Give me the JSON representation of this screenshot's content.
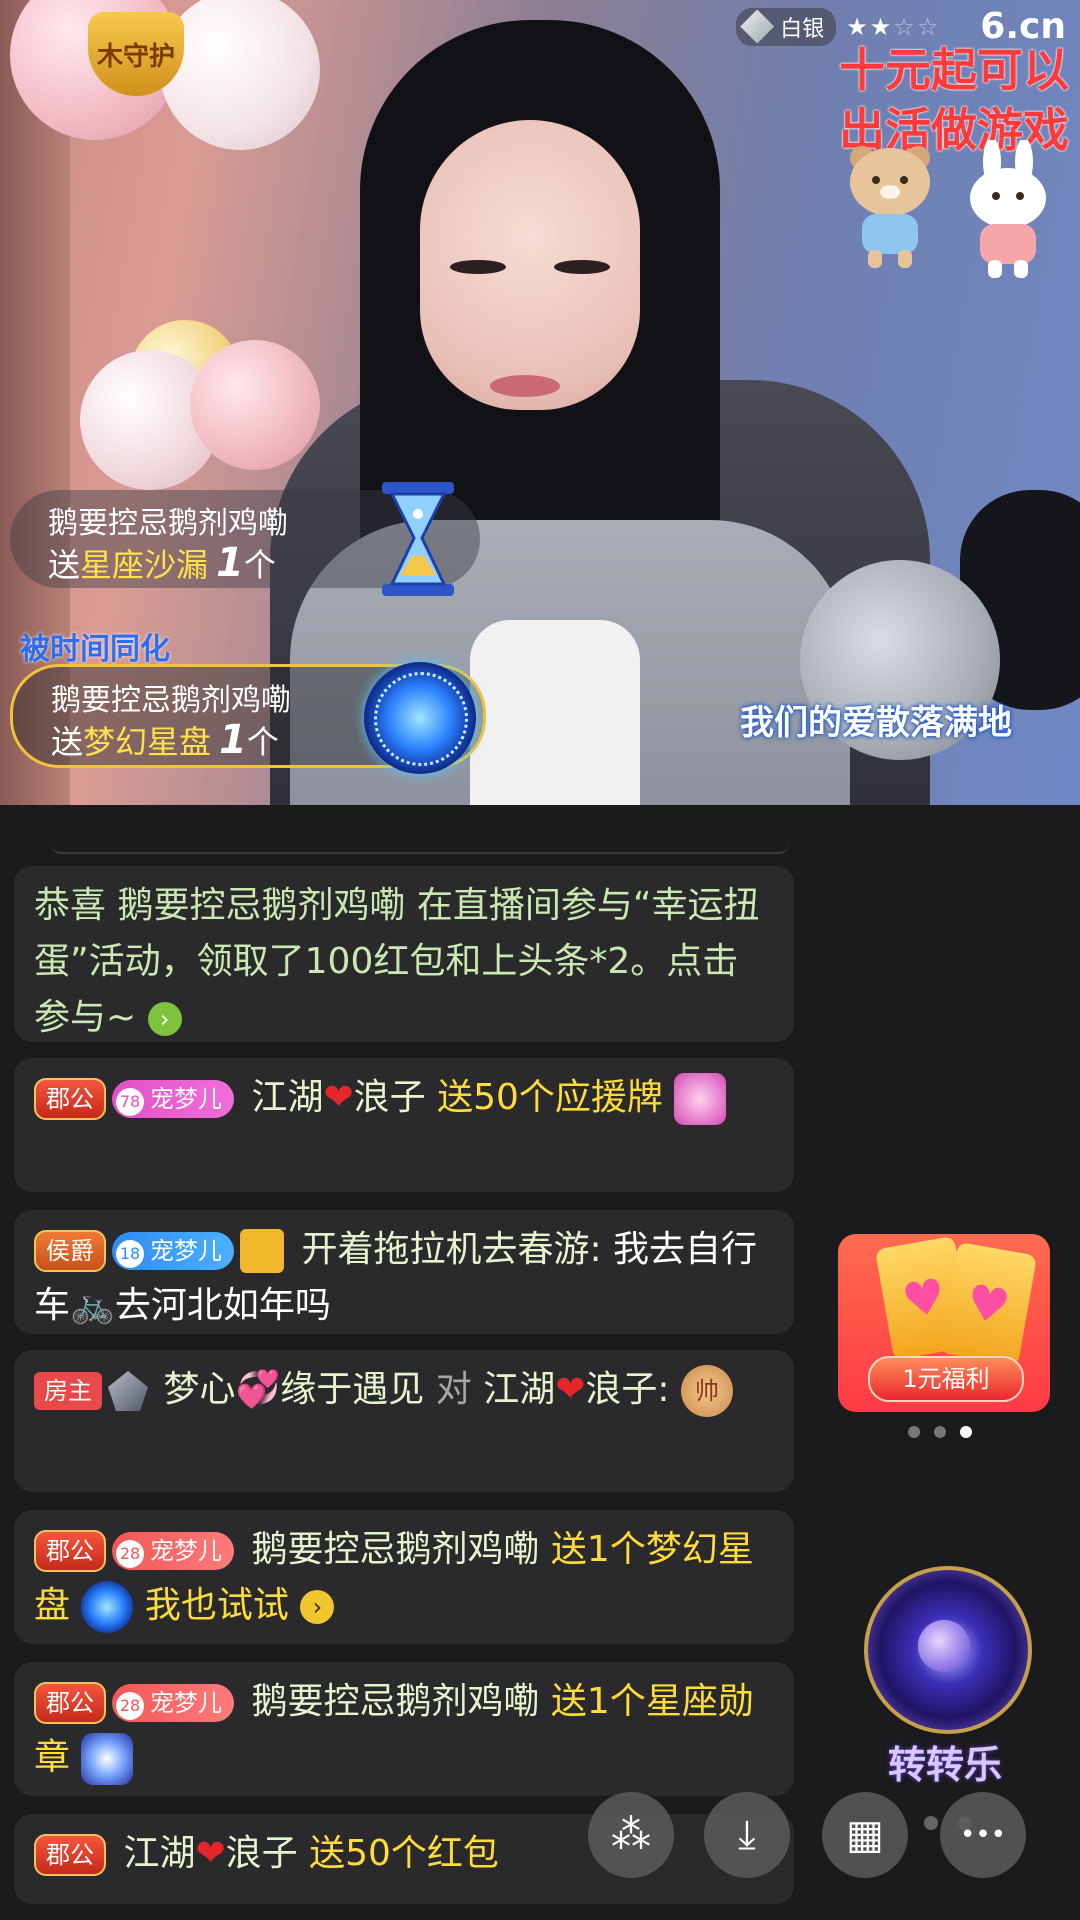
{
  "video": {
    "guard_label": "木守护",
    "rank_label": "白银",
    "stars_on": "★★",
    "stars_off": "☆☆",
    "brand": "6.cn",
    "promo_line1": "十元起可以",
    "promo_line2": "出活做游戏",
    "gift_popups": [
      {
        "user": "鹅要控忌鹅剂鸡嘞",
        "prefix": "送",
        "gift": "星座沙漏",
        "count": "1",
        "unit": "个"
      },
      {
        "user": "鹅要控忌鹅剂鸡嘞",
        "prefix": "送",
        "gift": "梦幻星盘",
        "count": "1",
        "unit": "个"
      }
    ],
    "float_title": "被时间同化",
    "lyric": "我们的爱散落满地"
  },
  "chat": {
    "msg1": {
      "p1": "恭喜 鹅要控忌鹅剂鸡嘞  在直播间参与“幸运扭蛋”活动，领取了100红包和上头条*2。点击参与~",
      "arrow": "›"
    },
    "msg2": {
      "rank": "郡公",
      "pet_level": "78",
      "pet_label": "宠梦儿",
      "name_a": "江湖",
      "heart": "❤",
      "name_b": "浪子",
      "gift": "送50个应援牌"
    },
    "msg3": {
      "rank": "侯爵",
      "pet_level": "18",
      "pet_label": "宠梦儿",
      "name": "开着拖拉机去春游:",
      "text_a": "我去自行车",
      "bike": "🚲",
      "text_b": "去河北如年吗"
    },
    "msg4": {
      "rank": "房主",
      "name_a": "梦心",
      "hearts": "💞",
      "name_b": "缘于遇见",
      "to": "对",
      "target_a": "江湖",
      "heart": "❤",
      "target_b": "浪子:",
      "shuai": "帅"
    },
    "msg5": {
      "rank": "郡公",
      "pet_level": "28",
      "pet_label": "宠梦儿",
      "name": "鹅要控忌鹅剂鸡嘞",
      "gift": "送1个梦幻星盘",
      "cta": "我也试试",
      "arrow": "›"
    },
    "msg6": {
      "rank": "郡公",
      "pet_level": "28",
      "pet_label": "宠梦儿",
      "name": "鹅要控忌鹅剂鸡嘞",
      "gift": "送1个星座勋章"
    },
    "msg7": {
      "rank": "郡公",
      "name_a": "江湖",
      "heart": "❤",
      "name_b": "浪子",
      "gift": "送50个红包"
    }
  },
  "widgets": {
    "ad_label": "1元福利",
    "spin_label": "转转乐"
  },
  "toolbar": {
    "share_glyph": "⁂",
    "download_glyph": "⤓",
    "grid_glyph": "▦",
    "more_glyph": "•••"
  }
}
